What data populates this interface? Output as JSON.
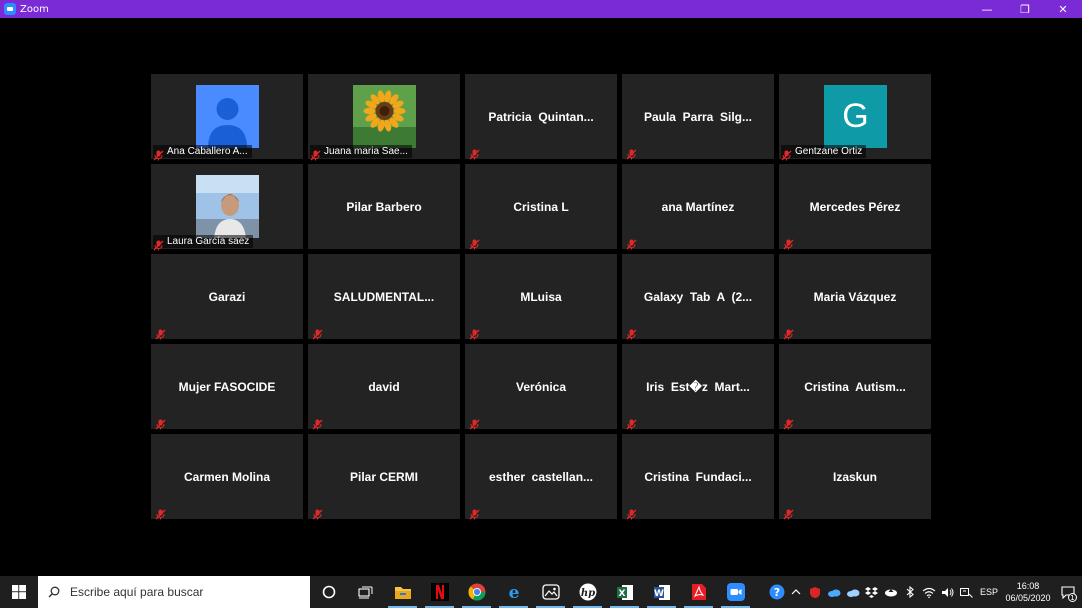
{
  "window": {
    "title": "Zoom",
    "controls": {
      "minimize": "—",
      "restore": "❐",
      "close": "✕"
    }
  },
  "participants": [
    {
      "name": "Ana Caballero A...",
      "video": "avatar-person",
      "muted": true
    },
    {
      "name": "Juana maria Sae...",
      "video": "sunflower-photo",
      "muted": true
    },
    {
      "name": "Patricia  Quintan...",
      "video": "none",
      "muted": true
    },
    {
      "name": "Paula  Parra  Silg...",
      "video": "none",
      "muted": true
    },
    {
      "name": "Gentzane Ortiz",
      "video": "letter-avatar",
      "letter": "G",
      "muted": true
    },
    {
      "name": "Laura García saez",
      "video": "camera-feed",
      "muted": true
    },
    {
      "name": "Pilar Barbero",
      "video": "none",
      "muted": false
    },
    {
      "name": "Cristina L",
      "video": "none",
      "muted": true
    },
    {
      "name": "ana Martínez",
      "video": "none",
      "muted": true
    },
    {
      "name": "Mercedes Pérez",
      "video": "none",
      "muted": true
    },
    {
      "name": "Garazi",
      "video": "none",
      "muted": true
    },
    {
      "name": "SALUDMENTAL...",
      "video": "none",
      "muted": true
    },
    {
      "name": "MLuisa",
      "video": "none",
      "muted": true
    },
    {
      "name": "Galaxy  Tab  A  (2...",
      "video": "none",
      "muted": true
    },
    {
      "name": "Maria Vázquez",
      "video": "none",
      "muted": true
    },
    {
      "name": "Mujer FASOCIDE",
      "video": "none",
      "muted": true
    },
    {
      "name": "david",
      "video": "none",
      "muted": true
    },
    {
      "name": "Verónica",
      "video": "none",
      "muted": true
    },
    {
      "name": "Iris  Est�z  Mart...",
      "video": "none",
      "muted": true
    },
    {
      "name": "Cristina  Autism...",
      "video": "none",
      "muted": true
    },
    {
      "name": "Carmen Molina",
      "video": "none",
      "muted": true
    },
    {
      "name": "Pilar CERMI",
      "video": "none",
      "muted": true
    },
    {
      "name": "esther  castellan...",
      "video": "none",
      "muted": true
    },
    {
      "name": "Cristina  Fundaci...",
      "video": "none",
      "muted": true
    },
    {
      "name": "Izaskun",
      "video": "none",
      "muted": true
    }
  ],
  "taskbar": {
    "search_placeholder": "Escribe aquí para buscar",
    "apps": [
      "cortana-icon",
      "task-view-icon",
      "file-explorer-icon",
      "netflix-icon",
      "chrome-icon",
      "edge-icon",
      "photos-icon",
      "hp-icon",
      "excel-icon",
      "word-icon",
      "acrobat-icon",
      "zoom-icon"
    ],
    "language": "ESP",
    "time": "16:08",
    "date": "06/05/2020",
    "notification_count": "1"
  },
  "colors": {
    "titlebar": "#7a2bd6",
    "tile": "#232323",
    "mute_red": "#e02828",
    "avatar_blue": "#4a8cff",
    "avatar_teal": "#0e9aa7",
    "taskbar": "#1f1f1f"
  }
}
